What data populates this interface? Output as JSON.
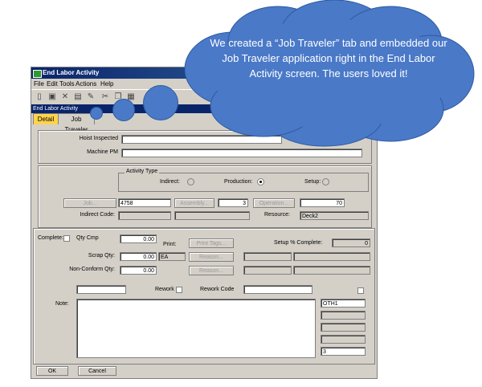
{
  "window": {
    "title": "End Labor Activity",
    "subtitle": "End Labor Activity"
  },
  "menu": [
    "File",
    "Edit",
    "Tools",
    "Actions",
    "Help"
  ],
  "tabs": [
    {
      "label": "Detail",
      "active": true
    },
    {
      "label": "Job Traveler",
      "active": false
    }
  ],
  "header": {
    "hoist_label": "Hoist Inspected",
    "machine_label": "Machine PM"
  },
  "activity": {
    "group_label": "Activity Type",
    "indirect_label": "Indirect:",
    "production_label": "Production:",
    "setup_label": "Setup:",
    "selected": "Production"
  },
  "job": {
    "job_button": "Job...",
    "job_value": "4758",
    "assembly_button": "Assembly...",
    "assembly_value": "3",
    "operation_button": "Operation...",
    "operation_value": "70",
    "indirect_code_label": "Indirect Code:",
    "resource_label": "Resource:",
    "resource_value": "Deck2"
  },
  "quantities": {
    "complete_label": "Complete:",
    "qty_cmp_label": "Qty Cmp",
    "qty_cmp_value": "0.00",
    "print_label": "Print:",
    "print_tags_button": "Print Tags...",
    "setup_complete_label": "Setup % Complete:",
    "setup_complete_value": "0",
    "scrap_label": "Scrap Qty:",
    "scrap_value": "0.00",
    "uom_value": "EA",
    "reason1_button": "Reason...",
    "nonconform_label": "Non-Conform Qty:",
    "nonconform_value": "0.00",
    "reason2_button": "Reason..."
  },
  "rework": {
    "rework_label": "Rework",
    "rework_code_label": "Rework Code"
  },
  "notes": {
    "note_label": "Note:",
    "side_value1": "OTH1",
    "side_value2": "3"
  },
  "footer": {
    "ok_button": "OK",
    "cancel_button": "Cancel"
  },
  "callout": {
    "text": "We created a “Job Traveler” tab and embedded our Job Traveler application right in the End Labor Activity screen.  The users loved it!",
    "color": "#4a79c8"
  }
}
